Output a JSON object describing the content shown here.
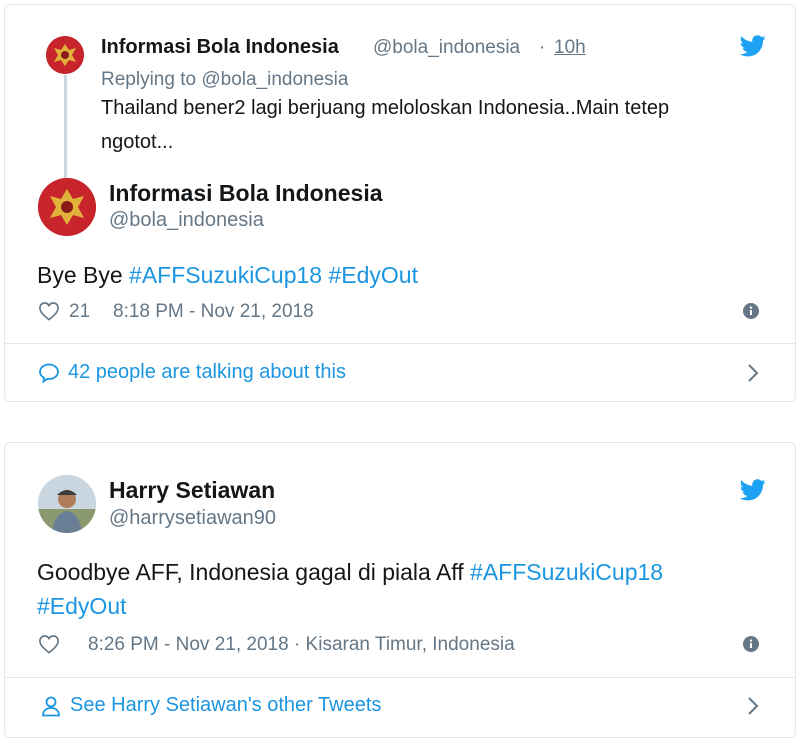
{
  "card1": {
    "quoted": {
      "name": "Informasi Bola Indonesia",
      "handle": "@bola_indonesia",
      "sep": "·",
      "time": "10h",
      "replying_prefix": "Replying to ",
      "replying_handle": "@bola_indonesia",
      "text_line1": "Thailand bener2 lagi berjuang meloloskan Indonesia..Main tetep",
      "text_line2": "ngotot..."
    },
    "author": {
      "name": "Informasi Bola Indonesia",
      "handle": "@bola_indonesia"
    },
    "tweet": {
      "text": "Bye Bye ",
      "hashtag1": "#AFFSuzukiCup18",
      "space": " ",
      "hashtag2": "#EdyOut"
    },
    "likes": "21",
    "timestamp": "8:18 PM - Nov 21, 2018",
    "footer_link": "42 people are talking about this"
  },
  "card2": {
    "author": {
      "name": "Harry Setiawan",
      "handle": "@harrysetiawan90"
    },
    "tweet": {
      "text": "Goodbye AFF, Indonesia gagal di piala Aff ",
      "hashtag1": "#AFFSuzukiCup18",
      "hashtag2": "#EdyOut"
    },
    "timestamp": "8:26 PM - Nov 21, 2018",
    "location": " · Kisaran Timur, Indonesia",
    "footer_link": "See Harry Setiawan's other Tweets"
  },
  "colors": {
    "twitter_blue": "#1da1f2",
    "link": "#1b95e0",
    "muted": "#657786",
    "border": "#e1e8ed"
  }
}
